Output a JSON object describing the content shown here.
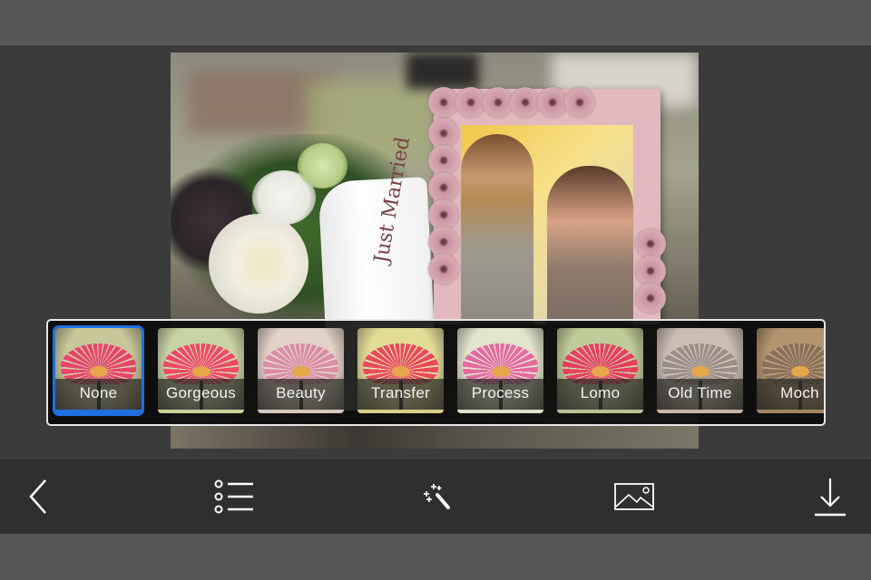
{
  "photo": {
    "ribbon_text": "Just Married",
    "description": "Wedding bouquet with pink flower frame containing couple"
  },
  "filters": {
    "selected_index": 0,
    "accent_color": "#1f6fe0",
    "items": [
      {
        "label": "None",
        "petal": "#e8456a",
        "bg": "#c8c79a",
        "base": "#1f6fe0"
      },
      {
        "label": "Gorgeous",
        "petal": "#ef4a67",
        "bg": "#c9d4a4",
        "base": "#c9d49a"
      },
      {
        "label": "Beauty",
        "petal": "#d98ea6",
        "bg": "#e3d2c6",
        "base": "#d6c9c0"
      },
      {
        "label": "Transfer",
        "petal": "#e84a5e",
        "bg": "#e3dc97",
        "base": "#d8d08a"
      },
      {
        "label": "Process",
        "petal": "#e56aa0",
        "bg": "#e2e4cc",
        "base": "#dfe0c8"
      },
      {
        "label": "Lomo",
        "petal": "#e83e5f",
        "bg": "#bfcb98",
        "base": "#b9c392"
      },
      {
        "label": "Old Time",
        "petal": "#9a8e86",
        "bg": "#cbbdb2",
        "base": "#c7b6aa"
      },
      {
        "label": "Moch",
        "petal": "#8a7058",
        "bg": "#b59470",
        "base": "#a4845f"
      }
    ]
  },
  "toolbar": {
    "back": {
      "icon": "chevron-left-icon"
    },
    "list": {
      "icon": "list-icon"
    },
    "effects": {
      "icon": "magic-wand-icon"
    },
    "background": {
      "icon": "image-icon"
    },
    "save": {
      "icon": "download-icon"
    }
  }
}
